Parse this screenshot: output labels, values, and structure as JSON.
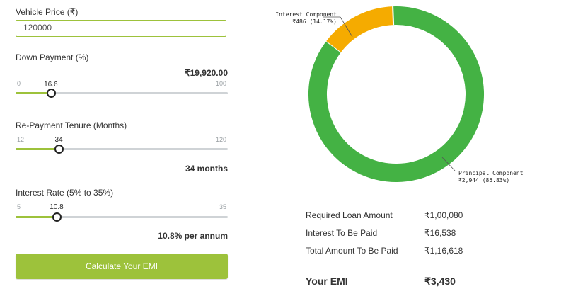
{
  "vehicle_price": {
    "label": "Vehicle Price (₹)",
    "value": "120000"
  },
  "down_payment": {
    "label": "Down Payment (%)",
    "amount": "₹19,920.00",
    "min": "0",
    "max": "100",
    "current": "16.6",
    "fraction": 0.166
  },
  "tenure": {
    "label": "Re-Payment Tenure (Months)",
    "min": "12",
    "max": "120",
    "current": "34",
    "fraction": 0.2037,
    "display": "34 months"
  },
  "interest": {
    "label": "Interest Rate (5% to 35%)",
    "min": "5",
    "max": "35",
    "current": "10.8",
    "fraction": 0.1933,
    "display": "10.8% per annum"
  },
  "calculate_label": "Calculate Your EMI",
  "summary": {
    "loan_label": "Required Loan Amount",
    "loan_value": "₹1,00,080",
    "interest_label": "Interest To Be Paid",
    "interest_value": "₹16,538",
    "total_label": "Total Amount To Be Paid",
    "total_value": "₹1,16,618",
    "emi_label": "Your EMI",
    "emi_value": "₹3,430"
  },
  "chart_data": {
    "type": "pie",
    "series": [
      {
        "name": "Interest Component",
        "label": "₹486 (14.17%)",
        "value": 14.17,
        "color": "#f5ab00"
      },
      {
        "name": "Principal Component",
        "label": "₹2,944 (85.83%)",
        "value": 85.83,
        "color": "#44b244"
      }
    ]
  }
}
